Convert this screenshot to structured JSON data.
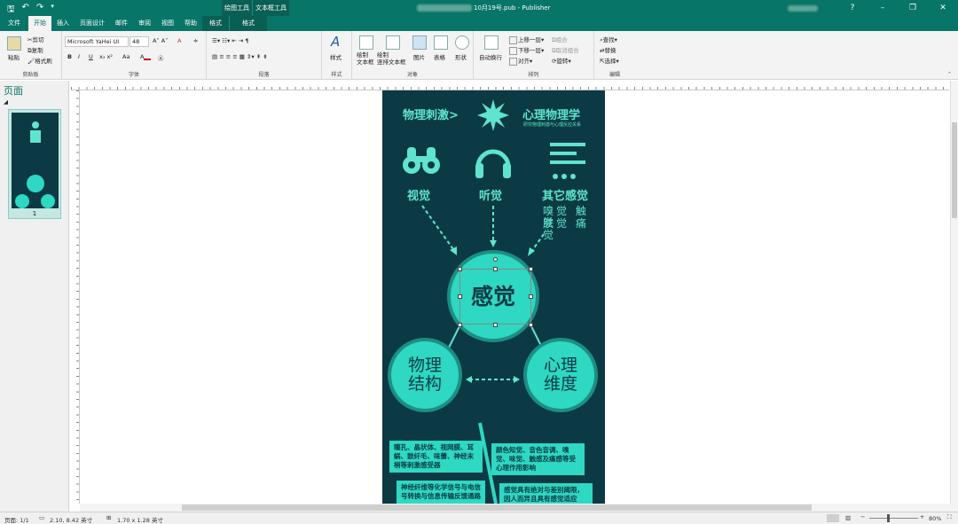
{
  "title_bar": {
    "context_tab_1": "绘图工具",
    "context_tab_2": "文本框工具",
    "doc_name": "10月19号.pub - Publisher",
    "help": "?"
  },
  "tabs": [
    "文件",
    "开始",
    "插入",
    "页面设计",
    "邮件",
    "审阅",
    "视图",
    "帮助",
    "格式",
    "格式"
  ],
  "ribbon": {
    "clipboard": {
      "paste": "粘贴",
      "cut": "剪切",
      "copy": "复制",
      "format_painter": "格式刷",
      "label": "剪贴板"
    },
    "font": {
      "font_name": "Microsoft YaHei UI",
      "font_size": "48",
      "bold": "B",
      "italic": "I",
      "underline": "U",
      "label": "字体"
    },
    "paragraph": {
      "label": "段落"
    },
    "styles": {
      "styles": "样式",
      "label": "样式"
    },
    "objects": {
      "draw_textbox": "绘制\n文本框",
      "draw_vertical": "绘制\n竖排文本框",
      "picture": "图片",
      "table": "表格",
      "shapes": "形状",
      "label": "对象"
    },
    "arrange": {
      "wrap": "自动换行",
      "bring_forward": "上移一层",
      "send_backward": "下移一层",
      "align": "对齐",
      "group": "组合",
      "ungroup": "取消组合",
      "rotate": "旋转",
      "label": "排列"
    },
    "editing": {
      "find": "查找",
      "replace": "替换",
      "select": "选择",
      "label": "编辑"
    }
  },
  "left_panel": {
    "header": "页面",
    "page_number": "1"
  },
  "page": {
    "top_left": "物理刺激>",
    "top_right": "心理物理学",
    "top_sub": "研究物理刺激与心理反应关系",
    "vision": "视觉",
    "hearing": "听觉",
    "other": "其它感觉",
    "other_sub1": "嗅觉 触觉",
    "other_sub2": "肤觉 痛觉",
    "center": "感觉",
    "left_circle_l1": "物理",
    "left_circle_l2": "结构",
    "right_circle_l1": "心理",
    "right_circle_l2": "维度",
    "box1": "瞳孔、晶状体、视网膜、耳蜗、鼓纤毛、味蕾、神经末梢等刺激感受器",
    "box2": "颜色知觉、音色音调、嗅觉、味觉、触感及痛感等受心理作用影响",
    "box3": "神经纤维等化学信号与电信号转换与信息传输反馈通路",
    "box4": "感觉具有绝对与差别阈限，因人而异且具有感觉适应"
  },
  "status": {
    "page": "页面: 1/1",
    "position": "2.10, 8.42 英寸",
    "size": "1.70 x 1.28 英寸",
    "zoom": "80%"
  }
}
